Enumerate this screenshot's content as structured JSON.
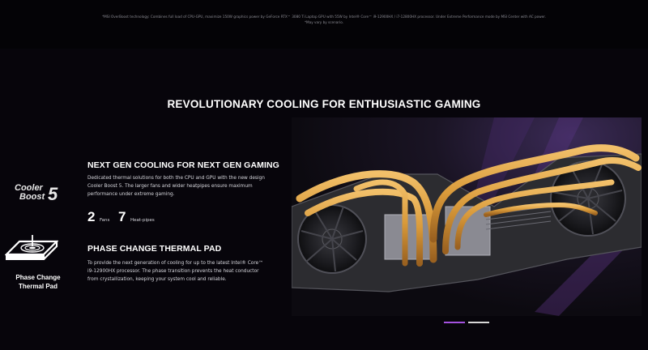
{
  "footnote": {
    "line1": "*MSI OverBoost technology: Combines full load of CPU-GPU, maximize 150W graphics power by GeForce RTX™ 3080 Ti Laptop GPU with 55W by Intel® Core™ i9-12900HX / i7-12800HX processor. Under Extreme Performance mode by MSI Center with AC power.",
    "line2": "*May vary by scenario."
  },
  "section": {
    "title": "REVOLUTIONARY COOLING FOR ENTHUSIASTIC GAMING"
  },
  "cooler_boost": {
    "logo_line1": "Cooler",
    "logo_line2": "Boost",
    "logo_number": "5",
    "heading": "NEXT GEN COOLING FOR NEXT GEN GAMING",
    "body": "Dedicated thermal solutions for both the CPU and GPU with the new design Cooler Boost 5. The larger fans and wider heatpipes ensure maximum performance under extreme gaming.",
    "stats": [
      {
        "value": "2",
        "label": "Fans"
      },
      {
        "value": "7",
        "label": "Heat-pipes"
      }
    ]
  },
  "phase_change": {
    "icon_label_line1": "Phase Change",
    "icon_label_line2": "Thermal Pad",
    "heading": "PHASE CHANGE THERMAL PAD",
    "body": "To provide the next generation of cooling for up to the latest Intel® Core™ i9-12900HX processor. The phase transition prevents the heat conductor from crystallization, keeping your system cool and reliable."
  },
  "carousel": {
    "slides": 2,
    "active_index": 0
  },
  "colors": {
    "background": "#07050b",
    "copper": "#d99a3a",
    "accent_purple": "#a452e0"
  }
}
